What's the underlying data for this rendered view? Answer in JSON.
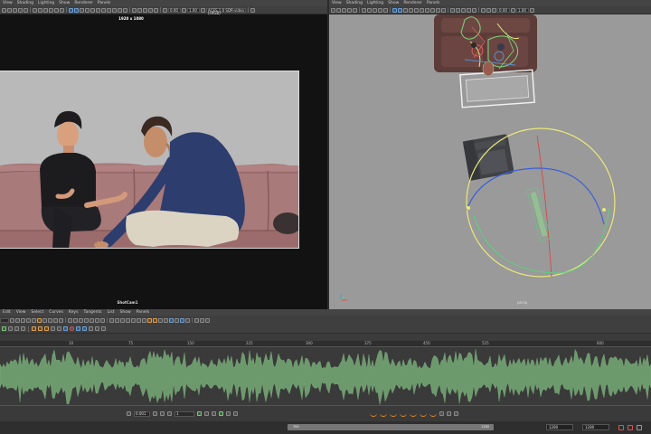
{
  "left_view": {
    "menus": [
      "View",
      "Shading",
      "Lighting",
      "Show",
      "Renderer",
      "Panels"
    ],
    "toolbar": {
      "field_a": "0.00",
      "field_b": "1.00",
      "colorspace": "ACES 1.0 SDR-video (sRGB)"
    },
    "resolution_label": "1920 x 1080",
    "camera_label": "ShotCam1"
  },
  "right_view": {
    "menus": [
      "View",
      "Shading",
      "Lighting",
      "Show",
      "Renderer",
      "Panels"
    ],
    "toolbar": {
      "field_a": "0.00",
      "field_b": "1.00"
    },
    "camera_label": "persp"
  },
  "graph_editor": {
    "menus": [
      "Edit",
      "View",
      "Select",
      "Curves",
      "Keys",
      "Tangents",
      "List",
      "Show",
      "Panels"
    ],
    "ruler_labels": [
      "10",
      "75",
      "150",
      "225",
      "300",
      "375",
      "450",
      "525",
      "600"
    ],
    "key_value": "0.001",
    "key_step": "1",
    "range": {
      "start_field": "1280",
      "end_field": "1280",
      "slider_start": "764",
      "slider_end": "1280"
    }
  },
  "colors": {
    "accent_blue": "#5a8ec8",
    "wave_green": "#6d9a6d",
    "selection_green": "#7cd67c",
    "orbit_yellow": "#e9e97a"
  }
}
